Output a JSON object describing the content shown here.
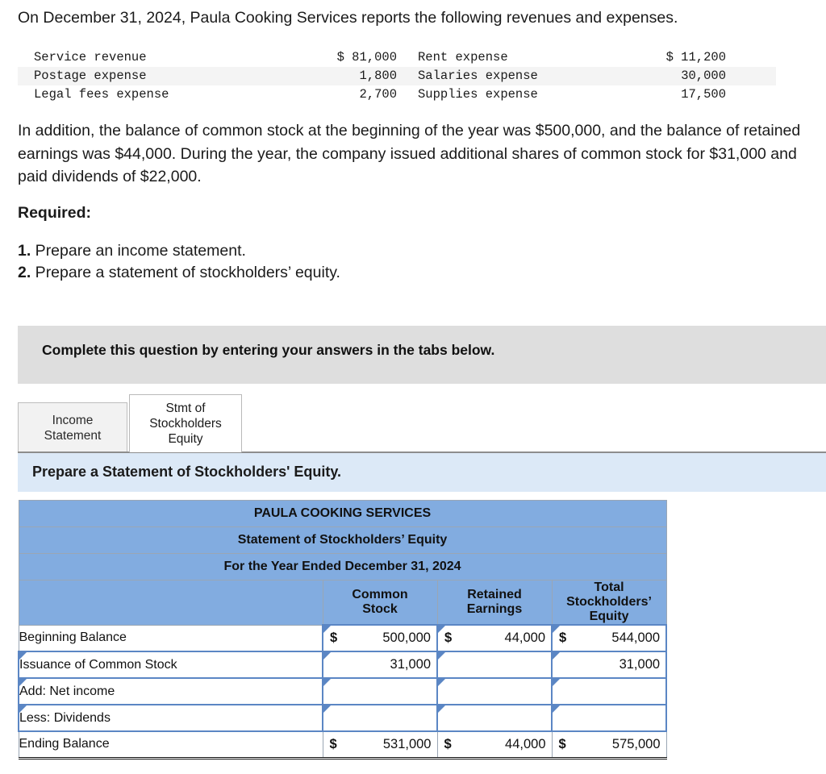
{
  "intro": {
    "text": "On December 31, 2024, Paula Cooking Services reports the following revenues and expenses."
  },
  "facts_table": {
    "rows": [
      {
        "left_label": "Service revenue",
        "left_symbol": "$",
        "left_amount": "81,000",
        "right_label": "Rent expense",
        "right_symbol": "$",
        "right_amount": "11,200"
      },
      {
        "left_label": "Postage expense",
        "left_symbol": "",
        "left_amount": "1,800",
        "right_label": "Salaries expense",
        "right_symbol": "",
        "right_amount": "30,000"
      },
      {
        "left_label": "Legal fees expense",
        "left_symbol": "",
        "left_amount": "2,700",
        "right_label": "Supplies expense",
        "right_symbol": "",
        "right_amount": "17,500"
      }
    ]
  },
  "paragraphs": {
    "addition": "In addition, the balance of common stock at the beginning of the year was $500,000, and the balance of retained earnings was $44,000. During the year, the company issued additional shares of common stock for $31,000 and paid dividends of $22,000.",
    "required_heading": "Required:"
  },
  "required_items": [
    {
      "number": "1.",
      "text": "Prepare an income statement."
    },
    {
      "number": "2.",
      "text": "Prepare a statement of stockholders’ equity."
    }
  ],
  "banner": {
    "text": "Complete this question by entering your answers in the tabs below."
  },
  "tabs": [
    {
      "id": "income-statement",
      "label": "Income Statement",
      "line1": "Income",
      "line2": "Statement",
      "active": false
    },
    {
      "id": "stmt-stockholders-equity",
      "label": "Stmt of Stockholders Equity",
      "line1": "Stmt of",
      "line2": "Stockholders",
      "line3": "Equity",
      "active": true
    }
  ],
  "prompt": {
    "text": "Prepare a Statement of Stockholders' Equity."
  },
  "statement": {
    "title_lines": [
      "PAULA COOKING SERVICES",
      "Statement of Stockholders’ Equity",
      "For the Year Ended December 31, 2024"
    ],
    "column_headers": [
      {
        "line1": "Common",
        "line2": "Stock"
      },
      {
        "line1": "Retained",
        "line2": "Earnings"
      },
      {
        "line1": "Total",
        "line2": "Stockholders’",
        "line3": "Equity"
      }
    ],
    "rows": [
      {
        "label": "Beginning Balance",
        "label_editable": false,
        "total_row": false,
        "cells": [
          {
            "symbol": "$",
            "value": "500,000",
            "editable": true
          },
          {
            "symbol": "$",
            "value": "44,000",
            "editable": true
          },
          {
            "symbol": "$",
            "value": "544,000",
            "editable": true
          }
        ]
      },
      {
        "label": "Issuance of Common Stock",
        "label_editable": true,
        "total_row": false,
        "cells": [
          {
            "symbol": "",
            "value": "31,000",
            "editable": true
          },
          {
            "symbol": "",
            "value": "",
            "editable": true
          },
          {
            "symbol": "",
            "value": "31,000",
            "editable": true
          }
        ]
      },
      {
        "label": "Add: Net income",
        "label_editable": true,
        "total_row": false,
        "cells": [
          {
            "symbol": "",
            "value": "",
            "editable": true
          },
          {
            "symbol": "",
            "value": "",
            "editable": true
          },
          {
            "symbol": "",
            "value": "",
            "editable": true
          }
        ]
      },
      {
        "label": "Less: Dividends",
        "label_editable": true,
        "total_row": false,
        "cells": [
          {
            "symbol": "",
            "value": "",
            "editable": true
          },
          {
            "symbol": "",
            "value": "",
            "editable": true
          },
          {
            "symbol": "",
            "value": "",
            "editable": true
          }
        ]
      },
      {
        "label": "Ending Balance",
        "label_editable": false,
        "total_row": true,
        "cells": [
          {
            "symbol": "$",
            "value": "531,000",
            "editable": false
          },
          {
            "symbol": "$",
            "value": "44,000",
            "editable": false
          },
          {
            "symbol": "$",
            "value": "575,000",
            "editable": false
          }
        ]
      }
    ]
  },
  "colors": {
    "header_blue": "#82ace0",
    "banner_gray": "#dedede",
    "prompt_blue": "#dce9f7",
    "input_border": "#5b86c4"
  }
}
